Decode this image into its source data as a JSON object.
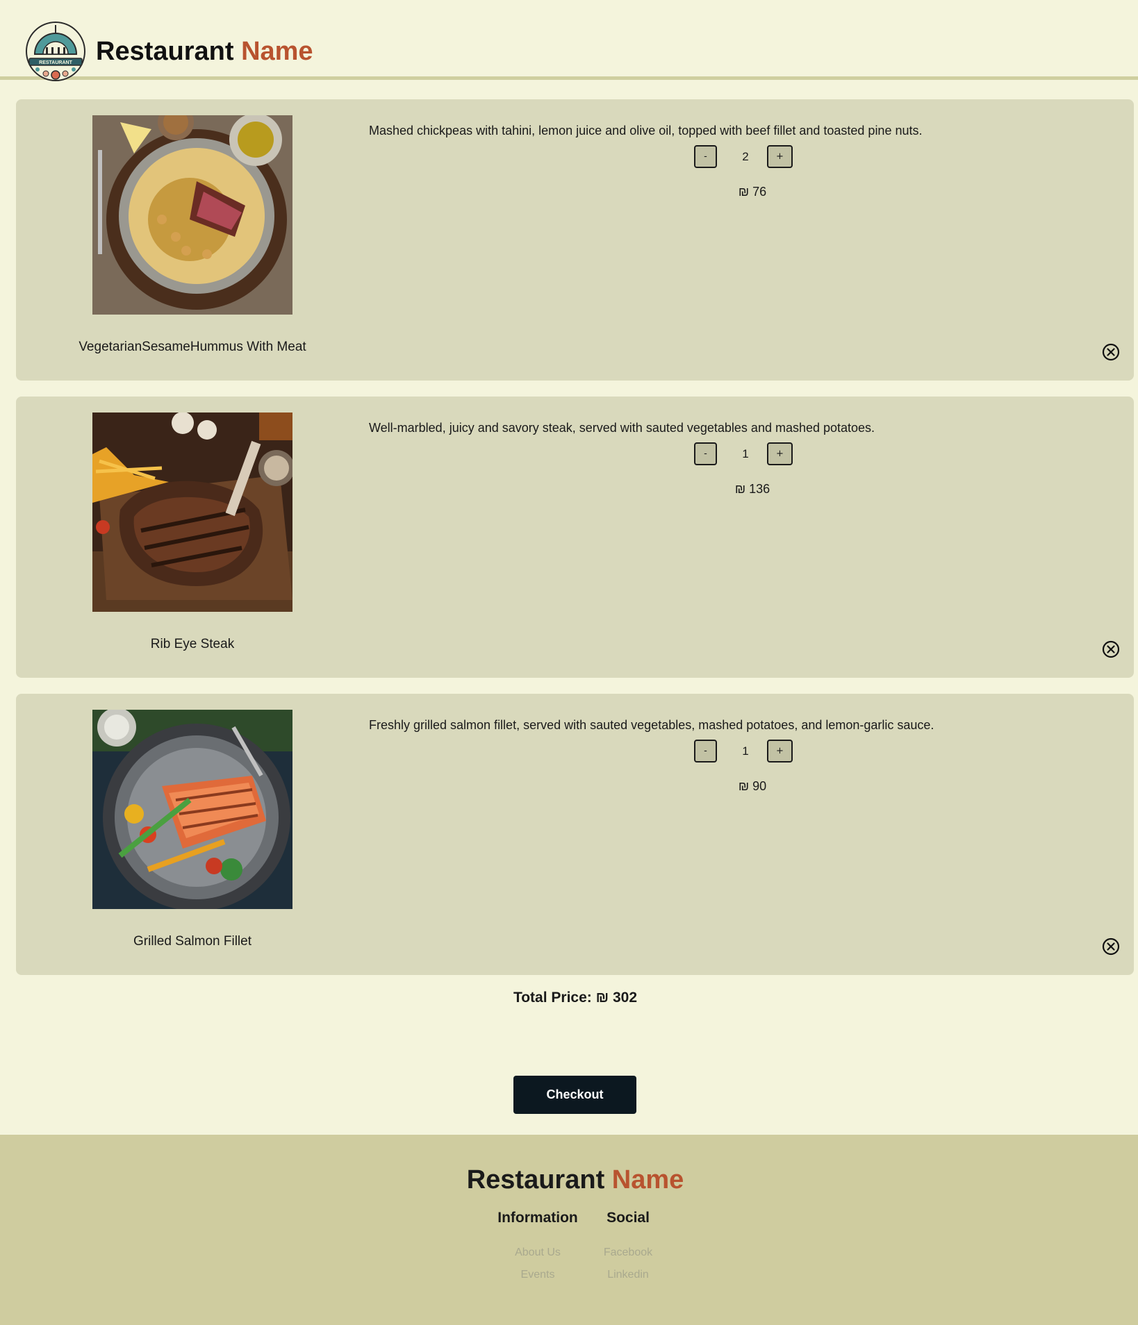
{
  "colors": {
    "page_bg": "#f4f4dc",
    "card_bg": "#d9d9bc",
    "accent": "#b8532f",
    "button_bg": "#0c1820",
    "footer_bg": "#cfcc9f",
    "footer_link": "#a9a98e"
  },
  "header": {
    "logo_icon": "restaurant-logo-icon",
    "logo_text": "RESTAURANT",
    "brand_primary": "Restaurant",
    "brand_accent": "Name"
  },
  "cart": {
    "items": [
      {
        "name": "VegetarianSesameHummus With Meat",
        "description": "Mashed chickpeas with tahini, lemon juice and olive oil, topped with beef fillet and toasted pine nuts.",
        "quantity": "2",
        "price": "₪ 76",
        "minus_label": "-",
        "plus_label": "+",
        "image": "hummus-with-meat-photo"
      },
      {
        "name": "Rib Eye Steak",
        "description": "Well-marbled, juicy and savory steak, served with sauted vegetables and mashed potatoes.",
        "quantity": "1",
        "price": "₪ 136",
        "minus_label": "-",
        "plus_label": "+",
        "image": "rib-eye-steak-photo"
      },
      {
        "name": "Grilled Salmon Fillet",
        "description": "Freshly grilled salmon fillet, served with sauted vegetables, mashed potatoes, and lemon-garlic sauce.",
        "quantity": "1",
        "price": "₪ 90",
        "minus_label": "-",
        "plus_label": "+",
        "image": "grilled-salmon-photo"
      }
    ],
    "remove_icon": "close-circle-icon",
    "total_label": "Total Price: ₪ 302",
    "checkout_label": "Checkout"
  },
  "footer": {
    "brand_primary": "Restaurant",
    "brand_accent": "Name",
    "information": {
      "title": "Information",
      "links": [
        "About Us",
        "Events"
      ]
    },
    "social": {
      "title": "Social",
      "links": [
        "Facebook",
        "Linkedin"
      ]
    }
  }
}
